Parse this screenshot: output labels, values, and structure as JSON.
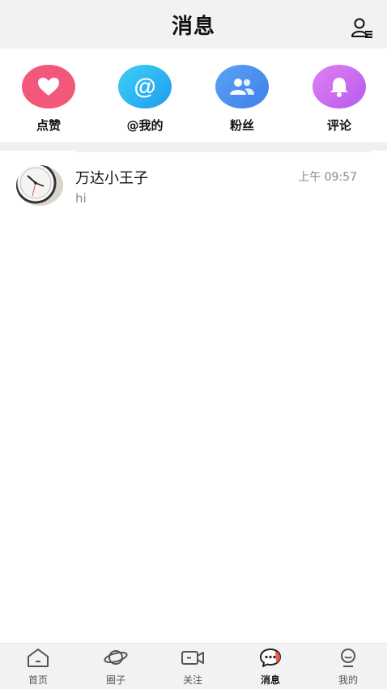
{
  "header": {
    "title": "消息",
    "right_icon": "contacts-icon"
  },
  "quick_actions": [
    {
      "label": "点赞",
      "icon": "heart-icon",
      "color": "#f2587a"
    },
    {
      "label": "@我的",
      "icon": "at-icon",
      "color": "#2db1f2"
    },
    {
      "label": "粉丝",
      "icon": "fans-icon",
      "color": "#4d8ff0"
    },
    {
      "label": "评论",
      "icon": "bell-icon",
      "color": "#c86ff0"
    }
  ],
  "conversations": [
    {
      "name": "万达小王子",
      "time": "上午 09:57",
      "preview": "hi",
      "avatar": "clock-avatar"
    }
  ],
  "tabbar": {
    "active": "消息",
    "items": [
      {
        "label": "首页",
        "icon": "home-icon"
      },
      {
        "label": "圈子",
        "icon": "planet-icon"
      },
      {
        "label": "关注",
        "icon": "video-icon"
      },
      {
        "label": "消息",
        "icon": "message-icon"
      },
      {
        "label": "我的",
        "icon": "profile-icon"
      }
    ]
  }
}
